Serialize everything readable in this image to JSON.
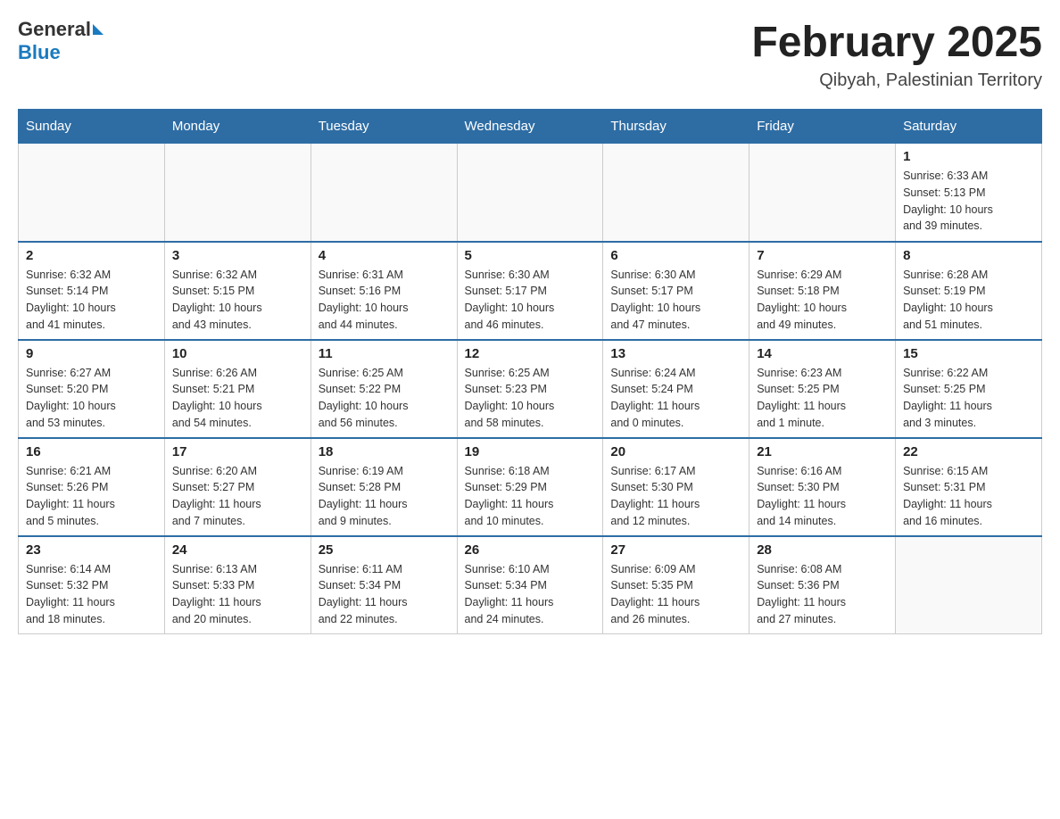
{
  "header": {
    "logo": {
      "general": "General",
      "blue": "Blue",
      "arrow": "▶"
    },
    "title": "February 2025",
    "location": "Qibyah, Palestinian Territory"
  },
  "weekdays": [
    "Sunday",
    "Monday",
    "Tuesday",
    "Wednesday",
    "Thursday",
    "Friday",
    "Saturday"
  ],
  "weeks": [
    [
      {
        "day": "",
        "info": ""
      },
      {
        "day": "",
        "info": ""
      },
      {
        "day": "",
        "info": ""
      },
      {
        "day": "",
        "info": ""
      },
      {
        "day": "",
        "info": ""
      },
      {
        "day": "",
        "info": ""
      },
      {
        "day": "1",
        "info": "Sunrise: 6:33 AM\nSunset: 5:13 PM\nDaylight: 10 hours\nand 39 minutes."
      }
    ],
    [
      {
        "day": "2",
        "info": "Sunrise: 6:32 AM\nSunset: 5:14 PM\nDaylight: 10 hours\nand 41 minutes."
      },
      {
        "day": "3",
        "info": "Sunrise: 6:32 AM\nSunset: 5:15 PM\nDaylight: 10 hours\nand 43 minutes."
      },
      {
        "day": "4",
        "info": "Sunrise: 6:31 AM\nSunset: 5:16 PM\nDaylight: 10 hours\nand 44 minutes."
      },
      {
        "day": "5",
        "info": "Sunrise: 6:30 AM\nSunset: 5:17 PM\nDaylight: 10 hours\nand 46 minutes."
      },
      {
        "day": "6",
        "info": "Sunrise: 6:30 AM\nSunset: 5:17 PM\nDaylight: 10 hours\nand 47 minutes."
      },
      {
        "day": "7",
        "info": "Sunrise: 6:29 AM\nSunset: 5:18 PM\nDaylight: 10 hours\nand 49 minutes."
      },
      {
        "day": "8",
        "info": "Sunrise: 6:28 AM\nSunset: 5:19 PM\nDaylight: 10 hours\nand 51 minutes."
      }
    ],
    [
      {
        "day": "9",
        "info": "Sunrise: 6:27 AM\nSunset: 5:20 PM\nDaylight: 10 hours\nand 53 minutes."
      },
      {
        "day": "10",
        "info": "Sunrise: 6:26 AM\nSunset: 5:21 PM\nDaylight: 10 hours\nand 54 minutes."
      },
      {
        "day": "11",
        "info": "Sunrise: 6:25 AM\nSunset: 5:22 PM\nDaylight: 10 hours\nand 56 minutes."
      },
      {
        "day": "12",
        "info": "Sunrise: 6:25 AM\nSunset: 5:23 PM\nDaylight: 10 hours\nand 58 minutes."
      },
      {
        "day": "13",
        "info": "Sunrise: 6:24 AM\nSunset: 5:24 PM\nDaylight: 11 hours\nand 0 minutes."
      },
      {
        "day": "14",
        "info": "Sunrise: 6:23 AM\nSunset: 5:25 PM\nDaylight: 11 hours\nand 1 minute."
      },
      {
        "day": "15",
        "info": "Sunrise: 6:22 AM\nSunset: 5:25 PM\nDaylight: 11 hours\nand 3 minutes."
      }
    ],
    [
      {
        "day": "16",
        "info": "Sunrise: 6:21 AM\nSunset: 5:26 PM\nDaylight: 11 hours\nand 5 minutes."
      },
      {
        "day": "17",
        "info": "Sunrise: 6:20 AM\nSunset: 5:27 PM\nDaylight: 11 hours\nand 7 minutes."
      },
      {
        "day": "18",
        "info": "Sunrise: 6:19 AM\nSunset: 5:28 PM\nDaylight: 11 hours\nand 9 minutes."
      },
      {
        "day": "19",
        "info": "Sunrise: 6:18 AM\nSunset: 5:29 PM\nDaylight: 11 hours\nand 10 minutes."
      },
      {
        "day": "20",
        "info": "Sunrise: 6:17 AM\nSunset: 5:30 PM\nDaylight: 11 hours\nand 12 minutes."
      },
      {
        "day": "21",
        "info": "Sunrise: 6:16 AM\nSunset: 5:30 PM\nDaylight: 11 hours\nand 14 minutes."
      },
      {
        "day": "22",
        "info": "Sunrise: 6:15 AM\nSunset: 5:31 PM\nDaylight: 11 hours\nand 16 minutes."
      }
    ],
    [
      {
        "day": "23",
        "info": "Sunrise: 6:14 AM\nSunset: 5:32 PM\nDaylight: 11 hours\nand 18 minutes."
      },
      {
        "day": "24",
        "info": "Sunrise: 6:13 AM\nSunset: 5:33 PM\nDaylight: 11 hours\nand 20 minutes."
      },
      {
        "day": "25",
        "info": "Sunrise: 6:11 AM\nSunset: 5:34 PM\nDaylight: 11 hours\nand 22 minutes."
      },
      {
        "day": "26",
        "info": "Sunrise: 6:10 AM\nSunset: 5:34 PM\nDaylight: 11 hours\nand 24 minutes."
      },
      {
        "day": "27",
        "info": "Sunrise: 6:09 AM\nSunset: 5:35 PM\nDaylight: 11 hours\nand 26 minutes."
      },
      {
        "day": "28",
        "info": "Sunrise: 6:08 AM\nSunset: 5:36 PM\nDaylight: 11 hours\nand 27 minutes."
      },
      {
        "day": "",
        "info": ""
      }
    ]
  ],
  "colors": {
    "header_bg": "#2e6da4",
    "border": "#ccc",
    "accent": "#1a7abf"
  }
}
